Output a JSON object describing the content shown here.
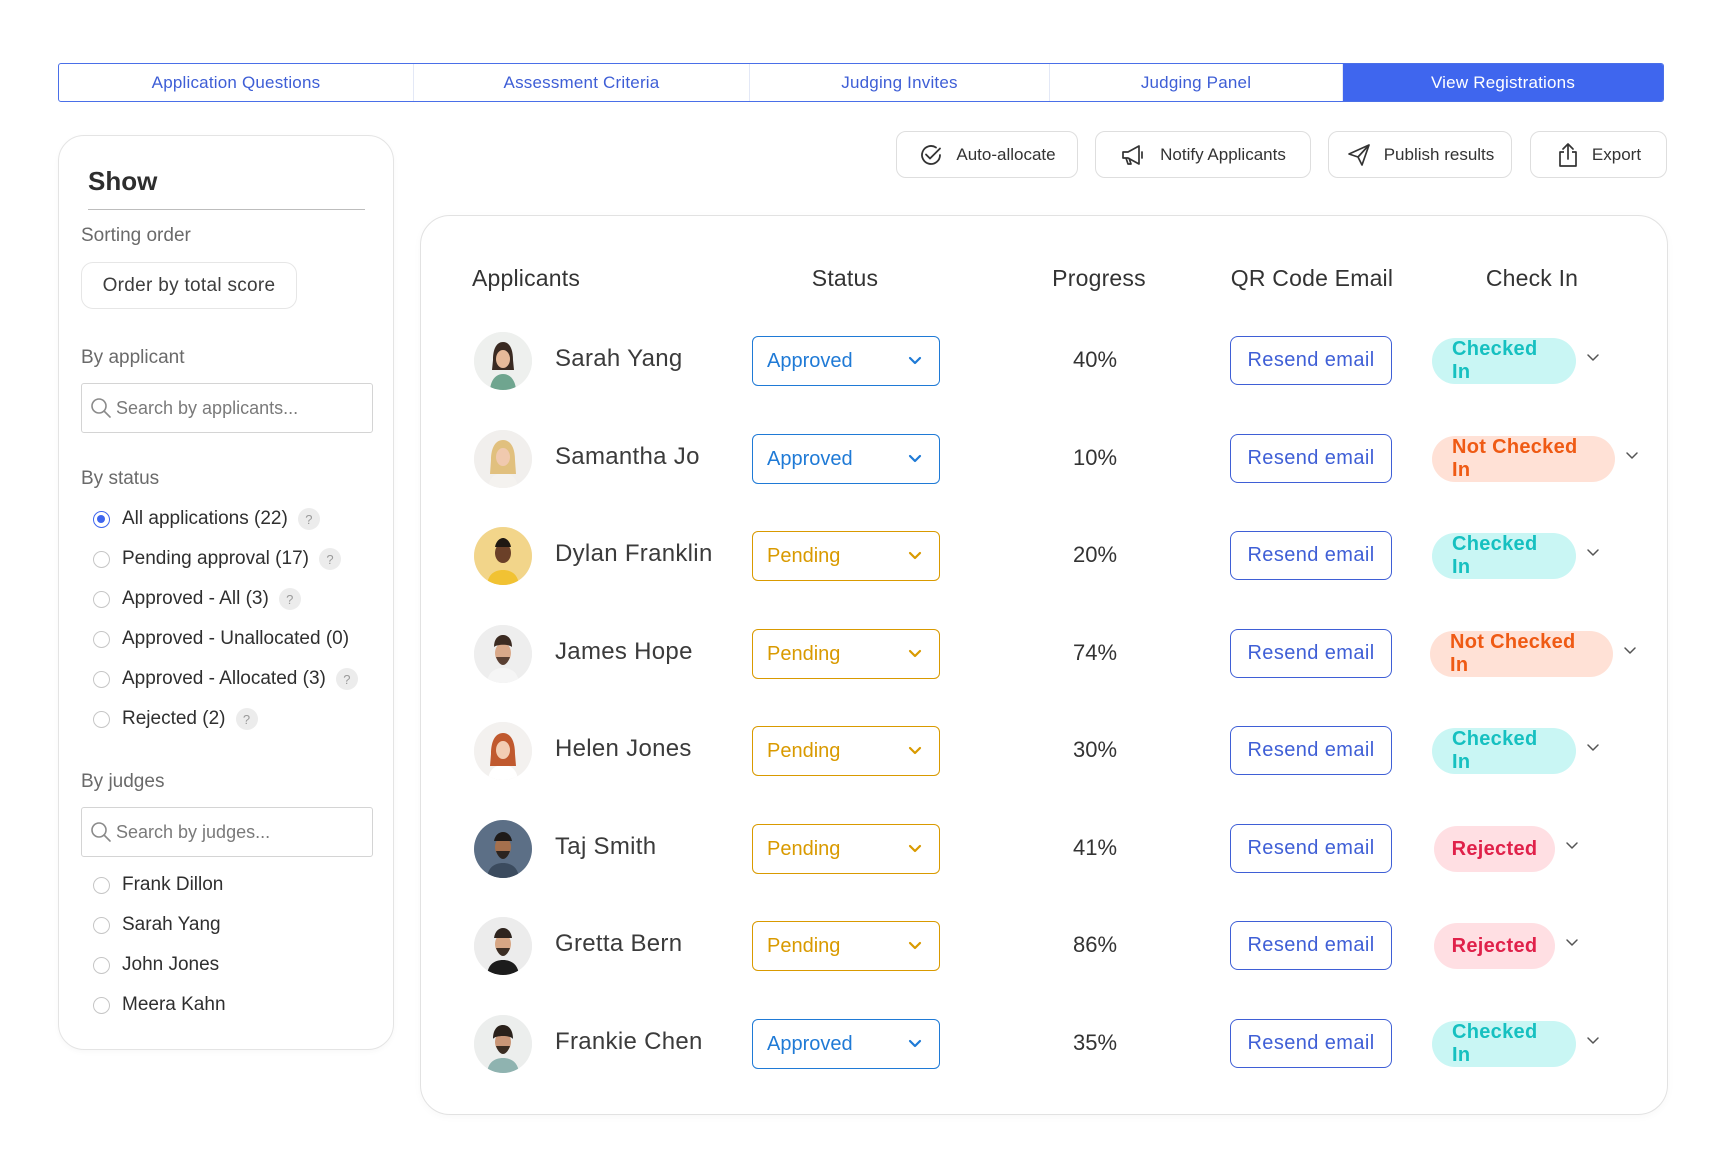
{
  "tabs": [
    {
      "label": "Application Questions",
      "active": false
    },
    {
      "label": "Assessment Criteria",
      "active": false
    },
    {
      "label": "Judging Invites",
      "active": false
    },
    {
      "label": "Judging Panel",
      "active": false
    },
    {
      "label": "View Registrations",
      "active": true
    }
  ],
  "sidebar": {
    "title": "Show",
    "sorting_label": "Sorting order",
    "sort_button": "Order by total score",
    "applicant_label": "By applicant",
    "applicant_search_placeholder": "Search by applicants...",
    "status_label": "By status",
    "status_filters": [
      {
        "label": "All applications (22)",
        "checked": true,
        "help": "?"
      },
      {
        "label": "Pending approval (17)",
        "checked": false,
        "help": "?"
      },
      {
        "label": "Approved - All (3)",
        "checked": false,
        "help": "?"
      },
      {
        "label": "Approved - Unallocated (0)",
        "checked": false,
        "help": ""
      },
      {
        "label": "Approved - Allocated (3)",
        "checked": false,
        "help": "?"
      },
      {
        "label": "Rejected (2)",
        "checked": false,
        "help": "?"
      }
    ],
    "judges_label": "By judges",
    "judges_search_placeholder": "Search by judges...",
    "judges": [
      "Frank Dillon",
      "Sarah Yang",
      "John Jones",
      "Meera Kahn"
    ]
  },
  "toolbar": {
    "auto_allocate": "Auto-allocate",
    "notify": "Notify Applicants",
    "publish": "Publish results",
    "export": "Export"
  },
  "table": {
    "headers": {
      "applicants": "Applicants",
      "status": "Status",
      "progress": "Progress",
      "qr": "QR Code Email",
      "checkin": "Check In"
    },
    "rows": [
      {
        "name": "Sarah Yang",
        "status": "Approved",
        "progress": "40%",
        "email_button": "Resend email",
        "checkin": "Checked In"
      },
      {
        "name": "Samantha Jo",
        "status": "Approved",
        "progress": "10%",
        "email_button": "Resend email",
        "checkin": "Not Checked In"
      },
      {
        "name": "Dylan Franklin",
        "status": "Pending",
        "progress": "20%",
        "email_button": "Resend email",
        "checkin": "Checked In"
      },
      {
        "name": "James Hope",
        "status": "Pending",
        "progress": "74%",
        "email_button": "Resend email",
        "checkin": "Not Checked In"
      },
      {
        "name": "Helen Jones",
        "status": "Pending",
        "progress": "30%",
        "email_button": "Resend email",
        "checkin": "Checked In"
      },
      {
        "name": "Taj Smith",
        "status": "Pending",
        "progress": "41%",
        "email_button": "Resend email",
        "checkin": "Rejected"
      },
      {
        "name": "Gretta Bern",
        "status": "Pending",
        "progress": "86%",
        "email_button": "Resend email",
        "checkin": "Rejected"
      },
      {
        "name": "Frankie Chen",
        "status": "Approved",
        "progress": "35%",
        "email_button": "Resend email",
        "checkin": "Checked In"
      }
    ]
  },
  "colors": {
    "accent": "#3f66ee",
    "approved": "#1f7ad6",
    "pending": "#d99a00",
    "checked_in_bg": "#c9f6f4",
    "checked_in_text": "#16c0c0",
    "not_checked_bg": "#ffe1d6",
    "not_checked_text": "#ef5a14",
    "rejected_bg": "#ffdfe3",
    "rejected_text": "#e0214a"
  }
}
